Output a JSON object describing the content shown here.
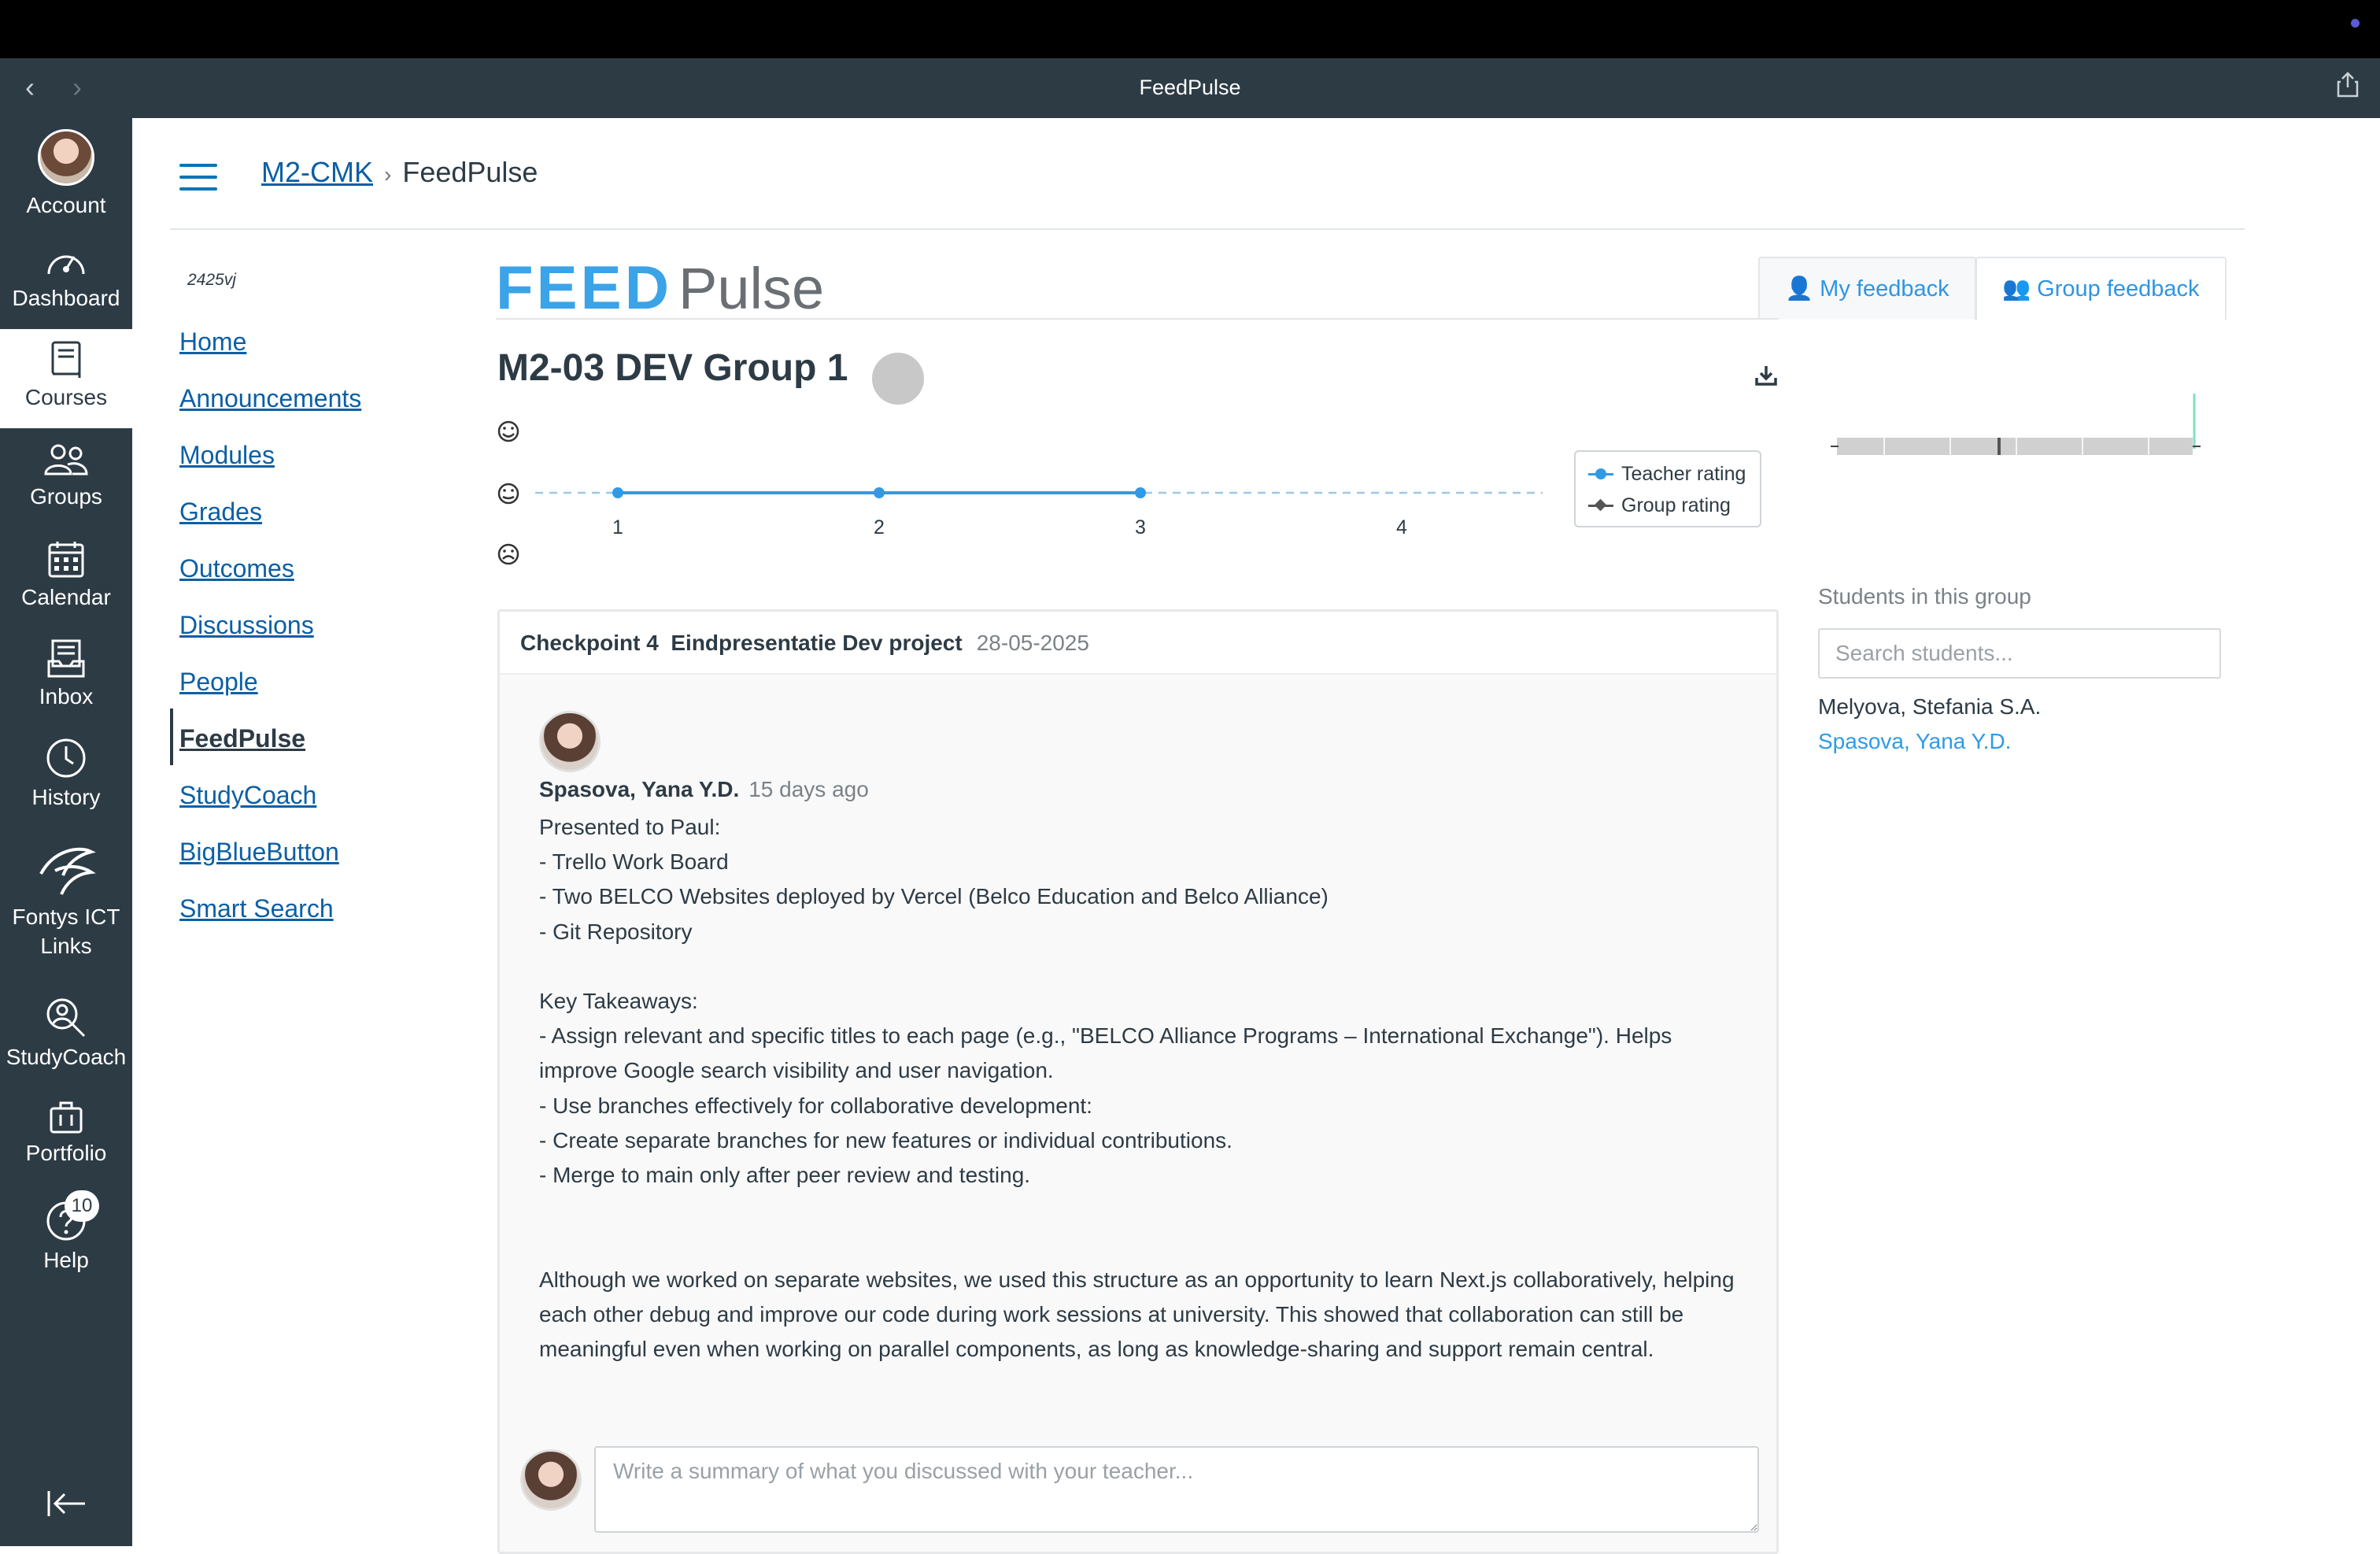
{
  "window": {
    "title": "FeedPulse"
  },
  "nav": {
    "account": "Account",
    "dashboard": "Dashboard",
    "courses": "Courses",
    "groups": "Groups",
    "calendar": "Calendar",
    "inbox": "Inbox",
    "history": "History",
    "links": "Fontys ICT Links",
    "studycoach": "StudyCoach",
    "portfolio": "Portfolio",
    "help": "Help",
    "help_badge": "10"
  },
  "breadcrumb": {
    "course": "M2-CMK",
    "page": "FeedPulse"
  },
  "course_nav": {
    "term": "2425vj",
    "items": [
      "Home",
      "Announcements",
      "Modules",
      "Grades",
      "Outcomes",
      "Discussions",
      "People",
      "FeedPulse",
      "StudyCoach",
      "BigBlueButton",
      "Smart Search"
    ],
    "active": "FeedPulse"
  },
  "logo": {
    "part1": "FEED",
    "part2": "Pulse"
  },
  "tabs": {
    "my": "My feedback",
    "group": "Group feedback",
    "active": "Group feedback"
  },
  "group": {
    "title": "M2-03 DEV Group 1"
  },
  "chart_data": {
    "type": "line",
    "x": [
      1,
      2,
      3,
      4
    ],
    "y_levels": [
      "sad-face-icon",
      "neutral-face-icon",
      "happy-face-icon"
    ],
    "series": [
      {
        "name": "Teacher rating",
        "color": "#2e9be6",
        "points": [
          [
            1,
            "neutral"
          ],
          [
            2,
            "neutral"
          ],
          [
            3,
            "neutral"
          ]
        ]
      },
      {
        "name": "Group rating",
        "color": "#555555",
        "points": []
      }
    ],
    "tick_labels": [
      "1",
      "2",
      "3",
      "4"
    ],
    "legend": "right"
  },
  "checkpoint": {
    "label": "Checkpoint 4",
    "name": "Eindpresentatie Dev project",
    "date": "28-05-2025",
    "author": "Spasova, Yana Y.D.",
    "time_ago": "15 days ago",
    "lines": [
      "Presented to Paul:",
      "- Trello Work Board",
      "- Two BELCO Websites deployed by Vercel (Belco Education and Belco Alliance)",
      "- Git Repository",
      "",
      "Key Takeaways:",
      "- Assign relevant and specific titles to each page (e.g., \"BELCO Alliance Programs – International Exchange\"). Helps improve Google search visibility and user navigation.",
      "- Use branches effectively for collaborative development:",
      "- Create separate branches for new features or individual contributions.",
      "- Merge to main only after peer review and testing.",
      "",
      "",
      "Although we worked on separate websites, we used this structure as an opportunity to learn Next.js collaboratively, helping each other debug and improve our code during work sessions at university. This showed that collaboration can still be meaningful even when working on parallel components, as long as knowledge-sharing and support remain central."
    ],
    "reply_placeholder": "Write a summary of what you discussed with your teacher..."
  },
  "students": {
    "label": "Students in this group",
    "search_placeholder": "Search students...",
    "list": [
      {
        "name": "Melyova, Stefania S.A.",
        "color": "#2d3b45"
      },
      {
        "name": "Spasova, Yana Y.D.",
        "color": "#2e9be6"
      }
    ]
  },
  "colors": {
    "nav_bg": "#2d3b45",
    "link": "#0b5fa5",
    "accent": "#2e9be6"
  }
}
